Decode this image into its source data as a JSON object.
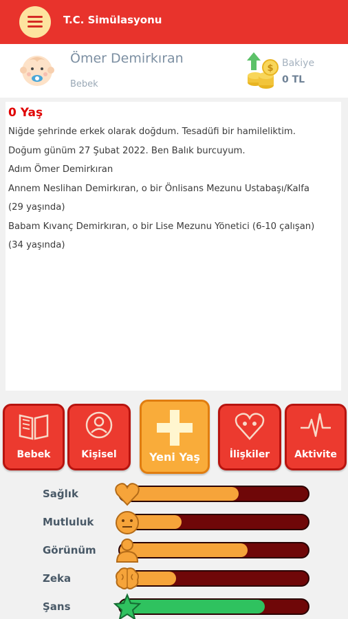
{
  "app": {
    "title": "T.C. Simülasyonu"
  },
  "profile": {
    "name": "Ömer Demirkıran",
    "role": "Bebek",
    "balance_label": "Bakiye",
    "balance_value": "0 TL"
  },
  "story": {
    "title": "0 Yaş",
    "lines": [
      "Niğde şehrinde erkek olarak doğdum. Tesadüfi bir hamileliktim.",
      "Doğum günüm 27 Şubat 2022. Ben Balık burcuyum.",
      "Adım Ömer Demirkıran",
      "Annem Neslihan Demirkıran, o bir Önlisans Mezunu Ustabaşı/Kalfa",
      "(29 yaşında)",
      "Babam Kıvanç Demirkıran, o bir Lise Mezunu Yönetici (6-10 çalışan)",
      "(34 yaşında)"
    ]
  },
  "actions": [
    {
      "label": "Bebek",
      "icon": "book-icon"
    },
    {
      "label": "Kişisel",
      "icon": "person-circle-icon"
    },
    {
      "label": "Yeni Yaş",
      "icon": "plus-icon",
      "active": true
    },
    {
      "label": "İlişkiler",
      "icon": "heart-people-icon"
    },
    {
      "label": "Aktivite",
      "icon": "pulse-icon"
    }
  ],
  "stats": [
    {
      "label": "Sağlık",
      "icon": "heart-icon",
      "level": 0.63,
      "color": "#f6a43a"
    },
    {
      "label": "Mutluluk",
      "icon": "face-icon",
      "level": 0.33,
      "color": "#f6a43a"
    },
    {
      "label": "Görünüm",
      "icon": "user-icon",
      "level": 0.68,
      "color": "#f6a43a"
    },
    {
      "label": "Zeka",
      "icon": "brain-icon",
      "level": 0.3,
      "color": "#f6a43a"
    },
    {
      "label": "Şans",
      "icon": "star-icon",
      "level": 0.77,
      "color": "#2fc25f"
    }
  ],
  "colors": {
    "appbar": "#e8332c",
    "card": "#ec3a2f",
    "card_active": "#f9ac3a",
    "title_red": "#e00000"
  }
}
